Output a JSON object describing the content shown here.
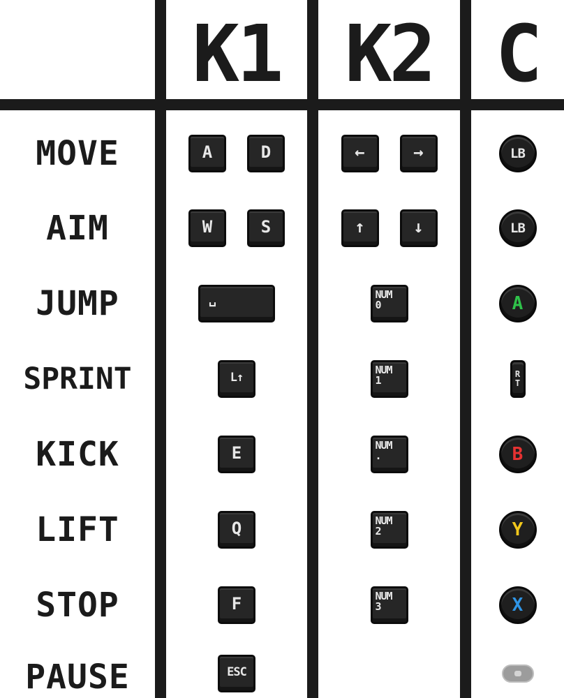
{
  "headers": {
    "k1": "K1",
    "k2": "K2",
    "c": "C"
  },
  "rows": [
    {
      "action": "MOVE",
      "k1": [
        "A",
        "D"
      ],
      "k2": [
        "←",
        "→"
      ],
      "c": {
        "label": "LB",
        "color": "#e8e8e8",
        "icon": "lb-button-icon"
      }
    },
    {
      "action": "AIM",
      "k1": [
        "W",
        "S"
      ],
      "k2": [
        "↑",
        "↓"
      ],
      "c": {
        "label": "LB",
        "color": "#e8e8e8",
        "icon": "lb-button-icon"
      }
    },
    {
      "action": "JUMP",
      "k1": [
        "␣"
      ],
      "k2": {
        "line1": "NUM",
        "line2": "0"
      },
      "c": {
        "label": "A",
        "color": "#2fc24a",
        "icon": "a-button-icon"
      }
    },
    {
      "action": "SPRINT",
      "k1": [
        "L↑"
      ],
      "k2": {
        "line1": "NUM",
        "line2": "1"
      },
      "c": {
        "line1": "R",
        "line2": "T",
        "color": "#e8e8e8",
        "icon": "rt-trigger-icon"
      }
    },
    {
      "action": "KICK",
      "k1": [
        "E"
      ],
      "k2": {
        "line1": "NUM",
        "line2": "."
      },
      "c": {
        "label": "B",
        "color": "#e63232",
        "icon": "b-button-icon"
      }
    },
    {
      "action": "LIFT",
      "k1": [
        "Q"
      ],
      "k2": {
        "line1": "NUM",
        "line2": "2"
      },
      "c": {
        "label": "Y",
        "color": "#f2c81c",
        "icon": "y-button-icon"
      }
    },
    {
      "action": "STOP",
      "k1": [
        "F"
      ],
      "k2": {
        "line1": "NUM",
        "line2": "3"
      },
      "c": {
        "label": "X",
        "color": "#2f95e6",
        "icon": "x-button-icon"
      }
    },
    {
      "action": "PAUSE",
      "k1": [
        "ESC"
      ],
      "c": {
        "icon": "start-button-icon"
      }
    }
  ]
}
